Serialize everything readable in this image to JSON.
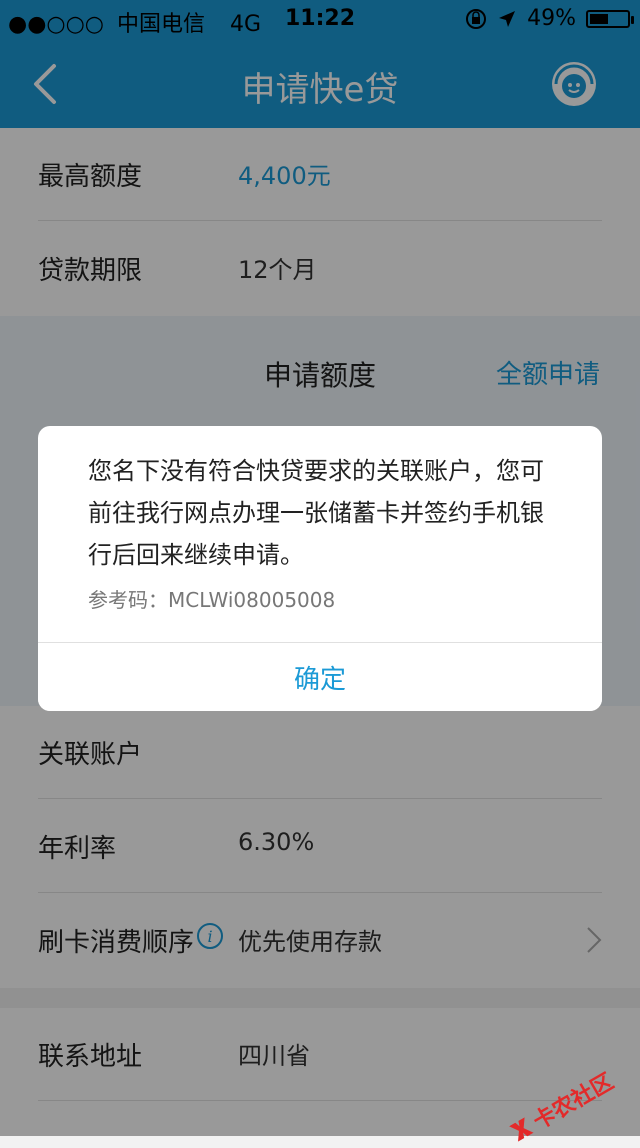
{
  "status_bar": {
    "signal": "●●○○○",
    "carrier": "中国电信",
    "network": "4G",
    "time": "11:22",
    "battery_text": "49%",
    "battery_level": 0.49
  },
  "nav": {
    "title": "申请快e贷",
    "back_icon": "back-chevron-icon",
    "service_icon": "customer-service-icon"
  },
  "top_section": {
    "rows": [
      {
        "label": "最高额度",
        "value": "4,400元"
      },
      {
        "label": "贷款期限",
        "value": "12个月"
      }
    ]
  },
  "apply": {
    "title": "申请额度",
    "full_apply": "全额申请"
  },
  "dialog": {
    "message": "您名下没有符合快贷要求的关联账户，您可前往我行网点办理一张储蓄卡并签约手机银行后回来继续申请。",
    "reference": "参考码：MCLWi08005008",
    "confirm": "确定"
  },
  "middle_section": {
    "rows": [
      {
        "label": "关联账户",
        "value": ""
      },
      {
        "label": "年利率",
        "value": "6.30%"
      },
      {
        "label": "刷卡消费顺序",
        "value": "优先使用存款"
      }
    ]
  },
  "bottom_section": {
    "rows": [
      {
        "label": "联系地址",
        "value": "四川省"
      }
    ]
  },
  "watermark": {
    "text": "卡农社区"
  },
  "colors": {
    "primary": "#1b9ad6"
  }
}
